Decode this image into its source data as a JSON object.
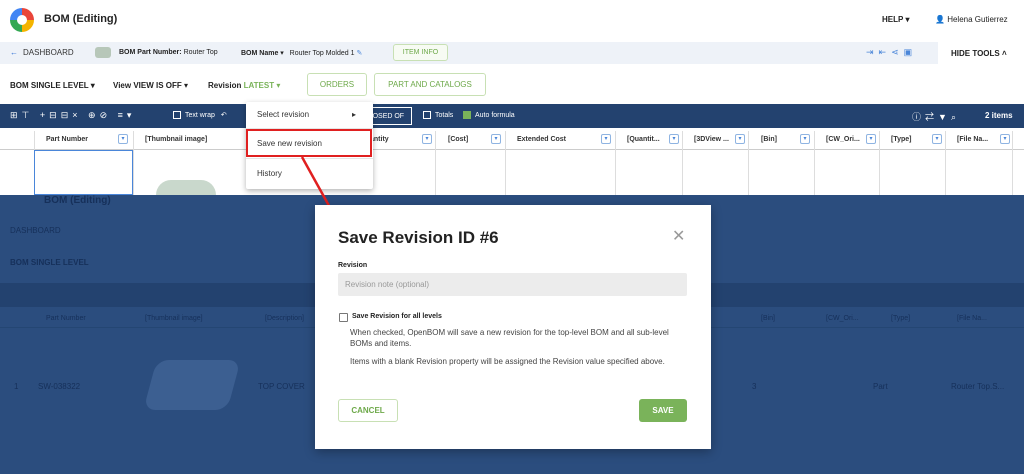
{
  "app": {
    "title": "BOM (Editing)",
    "help": "HELP",
    "user": "Helena Gutierrez"
  },
  "nav": {
    "dashboard": "DASHBOARD",
    "part_number_label": "BOM Part Number:",
    "part_number_value": "Router Top",
    "bom_name_label": "BOM Name",
    "bom_name_value": "Router Top Molded 1",
    "item_info": "ITEM INFO",
    "hide_tools": "HIDE TOOLS"
  },
  "toolbar": {
    "bom_level": "BOM SINGLE LEVEL",
    "view_label": "View",
    "view_value": "VIEW IS OFF",
    "revision_label": "Revision",
    "revision_value": "LATEST",
    "orders": "ORDERS",
    "part_catalogs": "PART AND CATALOGS"
  },
  "darkbar": {
    "text_wrap": "Text wrap",
    "posed_of": "POSED OF",
    "totals": "Totals",
    "auto_formula": "Auto formula",
    "items": "2 items"
  },
  "columns": [
    "Part Number",
    "[Thumbnail image]",
    "antity",
    "[Cost]",
    "Extended Cost",
    "[Quantit...",
    "[3DView ...",
    "[Bin]",
    "[CW_Ori...",
    "[Type]",
    "[File Na..."
  ],
  "revision_menu": {
    "select": "Select revision",
    "save_new": "Save new revision",
    "history": "History"
  },
  "background_row": {
    "index": "1",
    "part_number": "SW-038322",
    "description": "TOP COVER",
    "bin": "3",
    "type": "Part",
    "file_name": "Router Top.S...",
    "desc_header": "[Description]"
  },
  "dialog": {
    "title": "Save Revision ID #6",
    "revision_label": "Revision",
    "revision_placeholder": "Revision note (optional)",
    "checkbox_label": "Save Revision for all levels",
    "help1": "When checked, OpenBOM will save a new revision for the top-level BOM and all sub-level BOMs and items.",
    "help2": "Items with a blank Revision property will be assigned the Revision value specified above.",
    "cancel": "CANCEL",
    "save": "SAVE"
  },
  "colors": {
    "accent_green": "#7ab35a",
    "dark_navy": "#23426f",
    "highlight_red": "#e02020"
  }
}
